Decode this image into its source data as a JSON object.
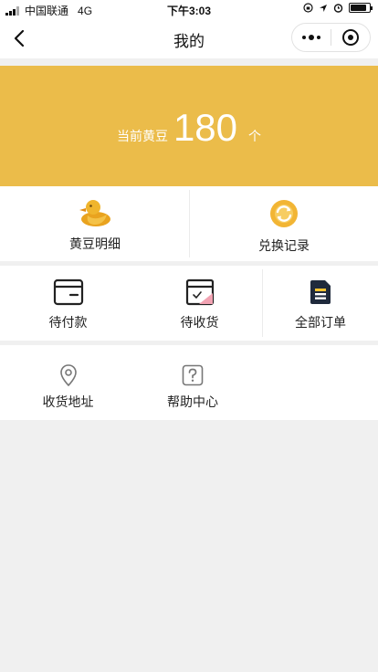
{
  "status_bar": {
    "carrier": "中国联通",
    "network": "4G",
    "time": "下午3:03"
  },
  "nav": {
    "title": "我的"
  },
  "points": {
    "label": "当前黄豆",
    "value": "180",
    "unit": "个"
  },
  "assets": [
    {
      "label": "黄豆明细",
      "icon": "duck-icon"
    },
    {
      "label": "兑换记录",
      "icon": "exchange-icon"
    }
  ],
  "orders": [
    {
      "label": "待付款",
      "icon": "wallet-icon"
    },
    {
      "label": "待收货",
      "icon": "package-icon"
    },
    {
      "label": "全部订单",
      "icon": "order-list-icon"
    }
  ],
  "services": [
    {
      "label": "收货地址",
      "icon": "location-pin-icon"
    },
    {
      "label": "帮助中心",
      "icon": "help-icon"
    }
  ],
  "colors": {
    "accent": "#ebbc4a",
    "background": "#f0f0f0"
  }
}
